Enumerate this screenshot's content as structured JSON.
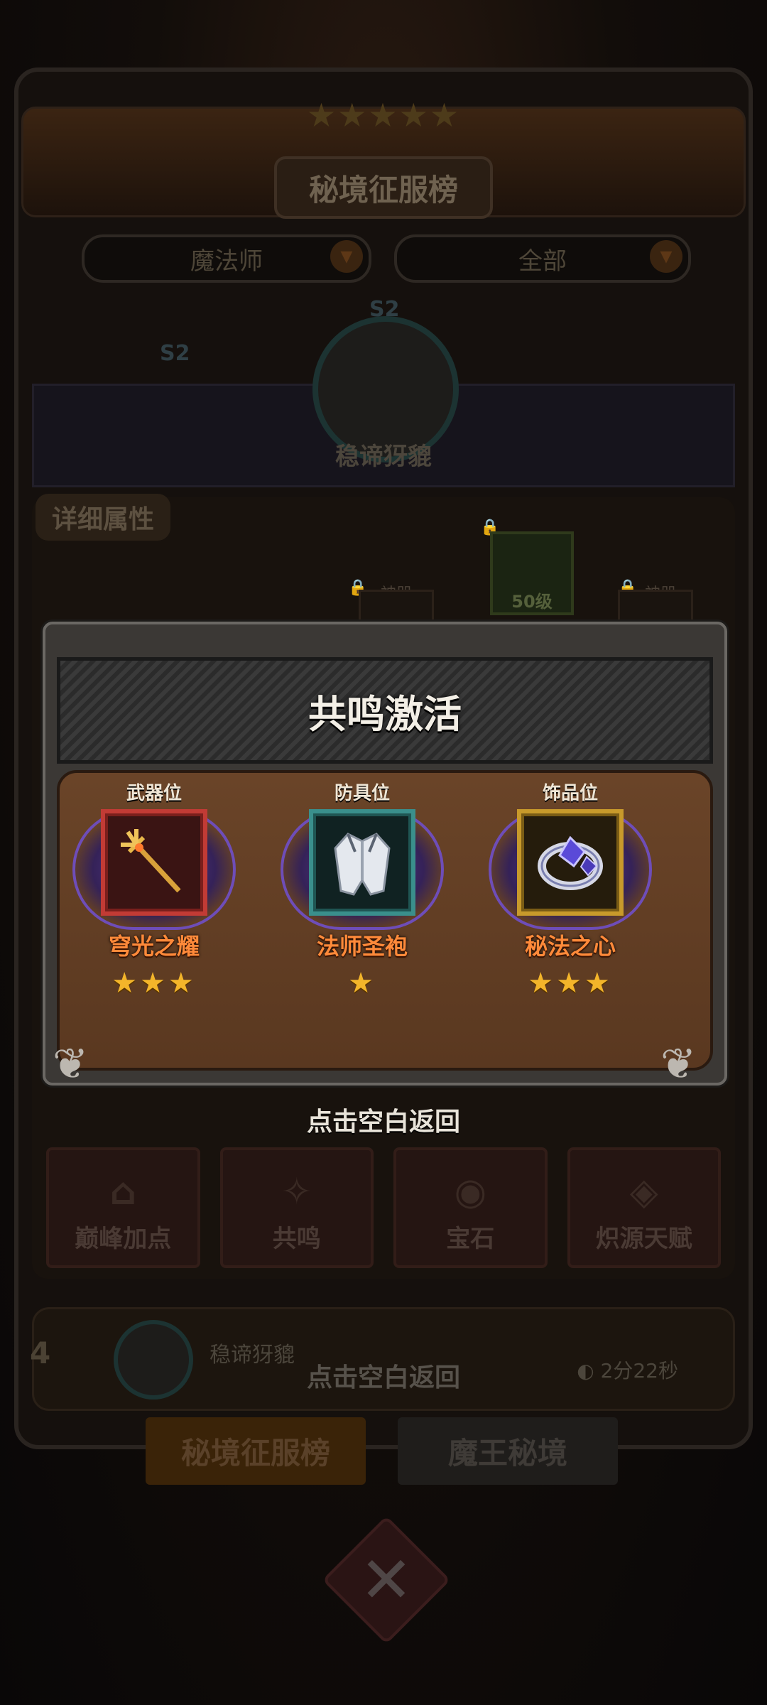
{
  "background": {
    "page_title": "秘境征服榜",
    "class_filter": "魔法师",
    "scope_filter": "全部",
    "season_badge_left": "S2",
    "season_badge_center": "S2",
    "player_name": "稳谛犽貔",
    "detail_tab": "详细属性",
    "locked_slot_label_1": "神器",
    "locked_slot_label_2": "神器",
    "level_slot_label": "50级",
    "func_buttons": [
      {
        "label": "巅峰加点",
        "icon": "house-plus-icon"
      },
      {
        "label": "共鸣",
        "icon": "resonance-icon"
      },
      {
        "label": "宝石",
        "icon": "gem-icon"
      },
      {
        "label": "炽源天赋",
        "icon": "talent-eye-icon"
      }
    ],
    "rank_row": {
      "rank": "4",
      "name": "稳谛犽貔",
      "time": "2分22秒",
      "hint": "点击空白返回"
    },
    "bottom_tabs": [
      {
        "label": "秘境征服榜",
        "active": true
      },
      {
        "label": "魔王秘境",
        "active": false
      }
    ]
  },
  "modal": {
    "title": "共鸣激活",
    "items": [
      {
        "slot": "武器位",
        "name": "穹光之耀",
        "stars": 3,
        "icon": "trident-icon",
        "rarity": "red"
      },
      {
        "slot": "防具位",
        "name": "法师圣袍",
        "stars": 1,
        "icon": "robe-icon",
        "rarity": "teal"
      },
      {
        "slot": "饰品位",
        "name": "秘法之心",
        "stars": 3,
        "icon": "ring-icon",
        "rarity": "gold"
      }
    ]
  },
  "close_hint": "点击空白返回",
  "colors": {
    "item_name": "#ff8a3a",
    "star": "#f3b52a",
    "modal_body": "#5a3820"
  }
}
